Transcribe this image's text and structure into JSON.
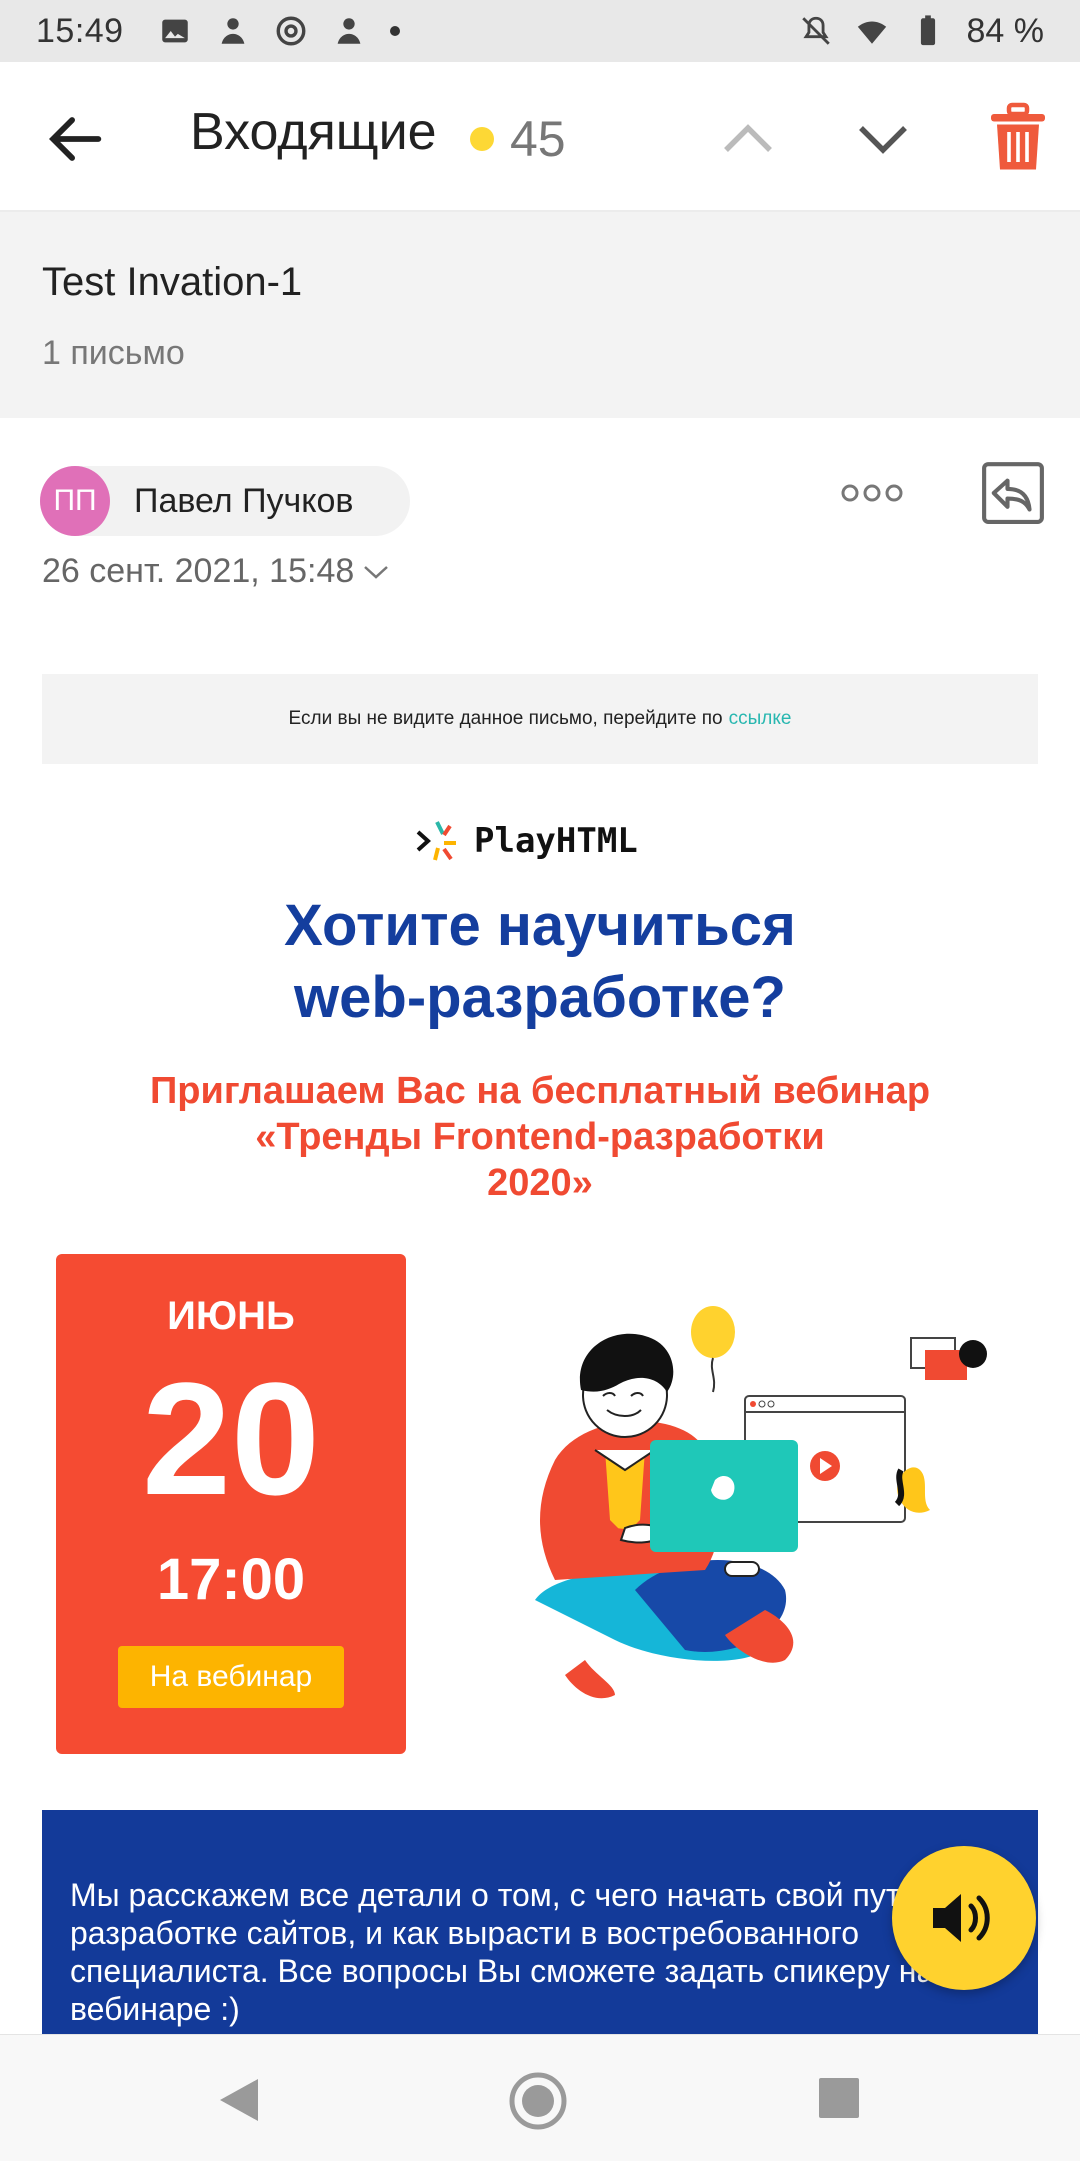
{
  "status_bar": {
    "time": "15:49",
    "battery": "84 %",
    "icons": [
      "image-icon",
      "person-icon",
      "at-icon",
      "person-icon",
      "dot-icon",
      "bell-off-icon",
      "wifi-icon",
      "battery-icon"
    ]
  },
  "header": {
    "title": "Входящие",
    "unread_count": "45",
    "unread_dot_color": "#fdd835"
  },
  "thread": {
    "subject": "Test Invation-1",
    "message_count": "1 письмо"
  },
  "message": {
    "sender_initials": "ПП",
    "sender_name": "Павел Пучков",
    "avatar_color": "#e070b8",
    "date": "26 сент. 2021, 15:48"
  },
  "email": {
    "notice_text": "Если вы не видите данное письмо, перейдите по",
    "notice_link": "ссылке",
    "brand": "PlayHTML",
    "headline_line1": "Хотите научиться",
    "headline_line2": "web-разработке?",
    "invite_line1": "Приглашаем Вас на бесплатный вебинар",
    "invite_line2": "«Тренды Frontend-разработки",
    "invite_line3": "2020»",
    "event_month": "ИЮНЬ",
    "event_day": "20",
    "event_time": "17:00",
    "event_cta": "На вебинар",
    "body_text": "Мы расскажем все детали о том, с чего начать свой путь в разработке сайтов, и как вырасти в востребованного специалиста. Все вопросы Вы сможете задать спикеру на вебинаре :)"
  },
  "colors": {
    "headline": "#143e9e",
    "accent_red": "#f04a32",
    "card_bg": "#f54b32",
    "cta_bg": "#fdb400",
    "blue_block": "#133a99",
    "fab": "#ffd22e",
    "trash": "#ef5a3c"
  }
}
